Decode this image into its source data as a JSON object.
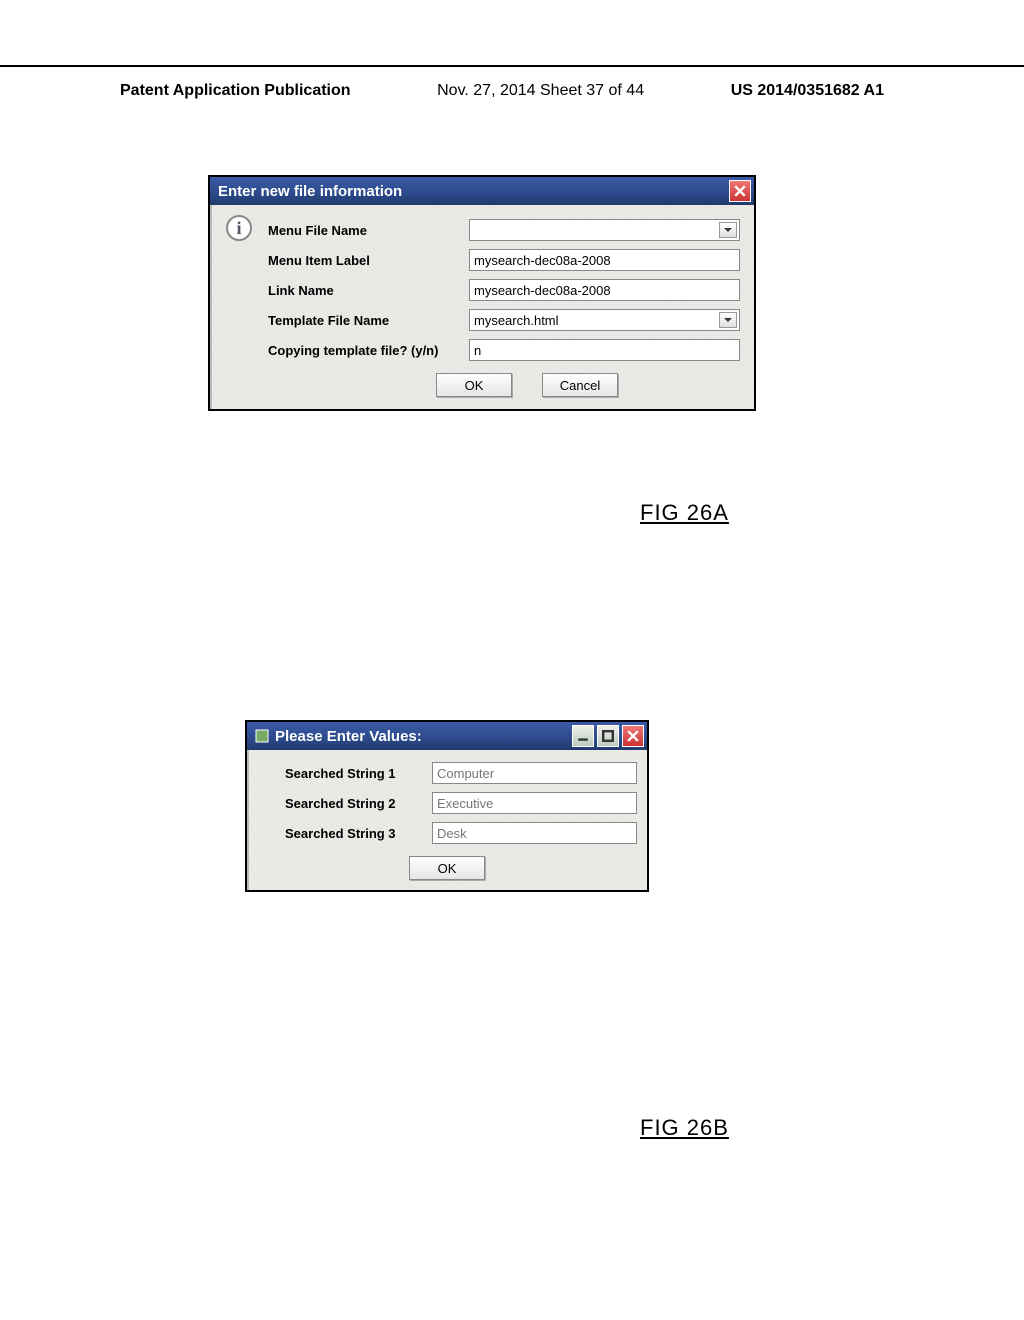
{
  "header": {
    "left": "Patent Application Publication",
    "center": "Nov. 27, 2014  Sheet 37 of 44",
    "right": "US 2014/0351682 A1"
  },
  "dialog1": {
    "title": "Enter new file information",
    "rows": [
      {
        "label": "Menu File Name",
        "value": "",
        "combo": true
      },
      {
        "label": "Menu Item Label",
        "value": "mysearch-dec08a-2008",
        "combo": false
      },
      {
        "label": "Link Name",
        "value": "mysearch-dec08a-2008",
        "combo": false
      },
      {
        "label": "Template File Name",
        "value": "mysearch.html",
        "combo": true
      },
      {
        "label": "Copying template file? (y/n)",
        "value": "n",
        "combo": false
      }
    ],
    "buttons": {
      "ok": "OK",
      "cancel": "Cancel"
    }
  },
  "dialog2": {
    "title": "Please Enter Values:",
    "rows": [
      {
        "label": "Searched String 1",
        "value": "Computer"
      },
      {
        "label": "Searched String 2",
        "value": "Executive"
      },
      {
        "label": "Searched String 3",
        "value": "Desk"
      }
    ],
    "buttons": {
      "ok": "OK"
    }
  },
  "figures": {
    "a": "FIG 26A",
    "b": "FIG 26B"
  }
}
